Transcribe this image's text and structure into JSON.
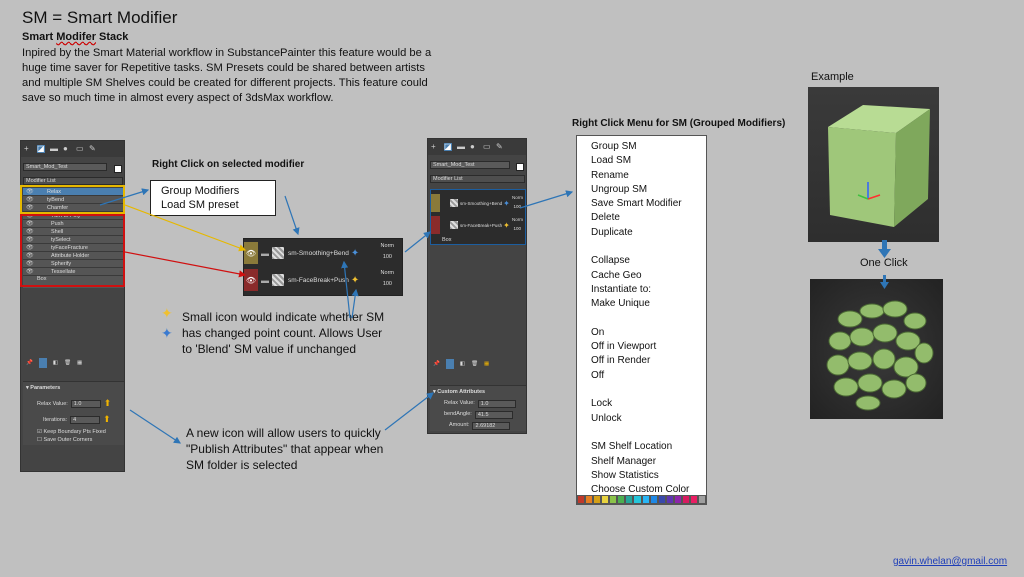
{
  "title": "SM = Smart Modifier",
  "subtitle_prefix": "Smart ",
  "subtitle_underlined": "Modifer",
  "subtitle_suffix": " Stack",
  "description": "Inpired by the Smart Material workflow in SubstancePainter this feature would be a huge time saver for Repetitive tasks. SM Presets could be shared between artists and multiple SM Shelves could be created for different projects. This feature could save so much time in almost every aspect of 3dsMax workflow.",
  "left_panel": {
    "object_name": "Smart_Mod_Test",
    "modifier_list": "Modifier List",
    "stack": [
      "Relax",
      "tyBend",
      "Chamfer",
      "Turn to Poly",
      "Push",
      "Shell",
      "tySelect",
      "tyFaceFracture",
      "Attribute Holder",
      "Spherify",
      "Tessellate"
    ],
    "base": "Box",
    "rollout_title": "Parameters",
    "relax_value_label": "Relax Value:",
    "relax_value": "1.0",
    "iterations_label": "Iterations:",
    "iterations_value": "4",
    "keep_boundary": "Keep Boundary Pts Fixed",
    "save_outer": "Save Outer Corners"
  },
  "right_click_label": "Right Click on selected modifier",
  "callout_lines": [
    "Group Modifiers",
    "Load SM preset"
  ],
  "sm_popup": {
    "rows": [
      {
        "name": "sm-Smoothing+Bend",
        "mode": "Norm",
        "value": "100"
      },
      {
        "name": "sm-FaceBreak+Push",
        "mode": "Norm",
        "value": "100"
      }
    ]
  },
  "small_icon_note": "Small icon would indicate whether SM has changed point count. Allows User to 'Blend' SM value if unchanged",
  "publish_note": "A new icon will allow users to quickly \"Publish Attributes\" that appear when SM folder is selected",
  "middle_panel": {
    "object_name": "Smart_Mod_Test",
    "modifier_list": "Modifier List",
    "rows": [
      {
        "name": "sm-Smoothing+Bend",
        "mode": "Norm",
        "value": "100"
      },
      {
        "name": "sm-FaceBreak+Push",
        "mode": "Norm",
        "value": "100"
      }
    ],
    "base": "Box",
    "rollout_title": "Custom Attributes",
    "relax_value_label": "Relax Value:",
    "relax_value": "1.0",
    "bend_angle_label": "bendAngle:",
    "bend_angle": "41.5",
    "amount_label": "Amount:",
    "amount": "2.69182"
  },
  "menu_title": "Right Click Menu for SM (Grouped Modifiers)",
  "menu_groups": [
    [
      "Group SM",
      "Load SM",
      "Rename",
      "Ungroup SM",
      "Save Smart Modifier",
      "Delete",
      "Duplicate"
    ],
    [
      "Collapse",
      "Cache Geo",
      "Instantiate to:",
      "Make Unique"
    ],
    [
      "On",
      "Off in Viewport",
      "Off in Render",
      "Off"
    ],
    [
      "Lock",
      "Unlock"
    ],
    [
      "SM Shelf Location",
      "Shelf Manager",
      "Show Statistics",
      "Choose Custom Color"
    ]
  ],
  "swatch_colors": [
    "#c0392b",
    "#e67e22",
    "#d4a017",
    "#e8d33f",
    "#8bc34a",
    "#4caf50",
    "#26a69a",
    "#26c6da",
    "#29b6f6",
    "#1e88e5",
    "#3949ab",
    "#5e35b1",
    "#8e24aa",
    "#d81b60",
    "#e91e63",
    "#9e9e9e"
  ],
  "example_label": "Example",
  "one_click_label": "One Click",
  "email": "gavin.whelan@gmail.com",
  "colors": {
    "accent_blue": "#2e75b6",
    "highlight_yellow": "#e6b800",
    "highlight_red": "#d01010",
    "sm_gold": "#8a7a3a",
    "sm_red": "#8a2b2b",
    "box_green": "#9fc77a"
  }
}
